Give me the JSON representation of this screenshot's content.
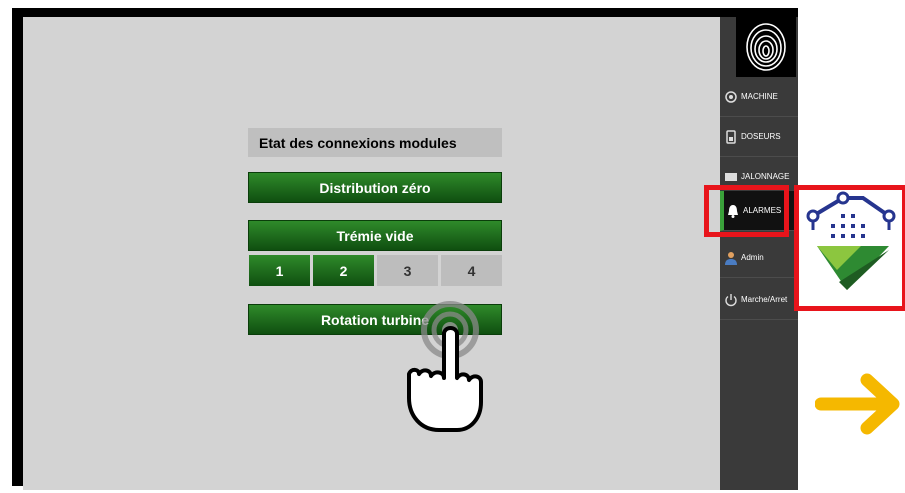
{
  "panel": {
    "title": "Etat des connexions modules",
    "buttons": [
      "Distribution zéro",
      "Trémie vide",
      "Rotation turbine"
    ],
    "trays": [
      "1",
      "2",
      "3",
      "4"
    ]
  },
  "sidebar": {
    "items": [
      {
        "label": "MACHINE",
        "icon": "gear-icon"
      },
      {
        "label": "DOSEURS",
        "icon": "device-icon"
      },
      {
        "label": "JALONNAGE",
        "icon": "flag-icon"
      },
      {
        "label": "ALARMES",
        "icon": "bell-icon"
      },
      {
        "label": "Admin",
        "icon": "user-icon"
      },
      {
        "label": "Marche/Arret",
        "icon": "power-icon"
      }
    ]
  },
  "colors": {
    "accent_green": "#1f6d1c",
    "highlight_red": "#e8141b",
    "arrow_yellow": "#f5b800",
    "badge_blue": "#26358f"
  }
}
